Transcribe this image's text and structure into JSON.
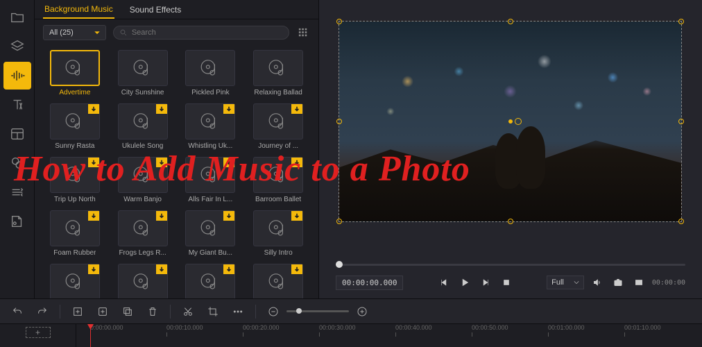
{
  "overlay_text": "How to Add Music to a Photo",
  "sidebar": {
    "tools": [
      "folder",
      "layers",
      "audio",
      "text",
      "layout",
      "effects",
      "transform",
      "export"
    ]
  },
  "tabs": {
    "items": [
      {
        "label": "Background Music",
        "active": true
      },
      {
        "label": "Sound Effects",
        "active": false
      }
    ]
  },
  "filter": {
    "dropdown": "All (25)",
    "search_placeholder": "Search"
  },
  "tracks": [
    {
      "name": "Advertime",
      "downloadable": false,
      "selected": true
    },
    {
      "name": "City Sunshine",
      "downloadable": false
    },
    {
      "name": "Pickled Pink",
      "downloadable": false
    },
    {
      "name": "Relaxing Ballad",
      "downloadable": false
    },
    {
      "name": "Sunny Rasta",
      "downloadable": true
    },
    {
      "name": "Ukulele Song",
      "downloadable": true
    },
    {
      "name": "Whistling Uk...",
      "downloadable": true
    },
    {
      "name": "Journey of ...",
      "downloadable": true
    },
    {
      "name": "Trip Up North",
      "downloadable": true
    },
    {
      "name": "Warm Banjo",
      "downloadable": true
    },
    {
      "name": "Alls Fair In L...",
      "downloadable": true
    },
    {
      "name": "Barroom Ballet",
      "downloadable": true
    },
    {
      "name": "Foam Rubber",
      "downloadable": true
    },
    {
      "name": "Frogs Legs R...",
      "downloadable": true
    },
    {
      "name": "My Giant Bu...",
      "downloadable": true
    },
    {
      "name": "Silly Intro",
      "downloadable": true
    },
    {
      "name": "",
      "downloadable": true
    },
    {
      "name": "",
      "downloadable": true
    },
    {
      "name": "",
      "downloadable": true
    },
    {
      "name": "",
      "downloadable": true
    }
  ],
  "preview": {
    "timecode": "00:00:00.000",
    "duration": "00:00:00",
    "size_mode": "Full"
  },
  "timeline": {
    "marks": [
      {
        "label": "0:00:00.000",
        "pos": 20
      },
      {
        "label": "00:00:10.000",
        "pos": 130
      },
      {
        "label": "00:00:20.000",
        "pos": 240
      },
      {
        "label": "00:00:30.000",
        "pos": 350
      },
      {
        "label": "00:00:40.000",
        "pos": 460
      },
      {
        "label": "00:00:50.000",
        "pos": 570
      },
      {
        "label": "00:01:00.000",
        "pos": 680
      },
      {
        "label": "00:01:10.000",
        "pos": 790
      }
    ]
  }
}
